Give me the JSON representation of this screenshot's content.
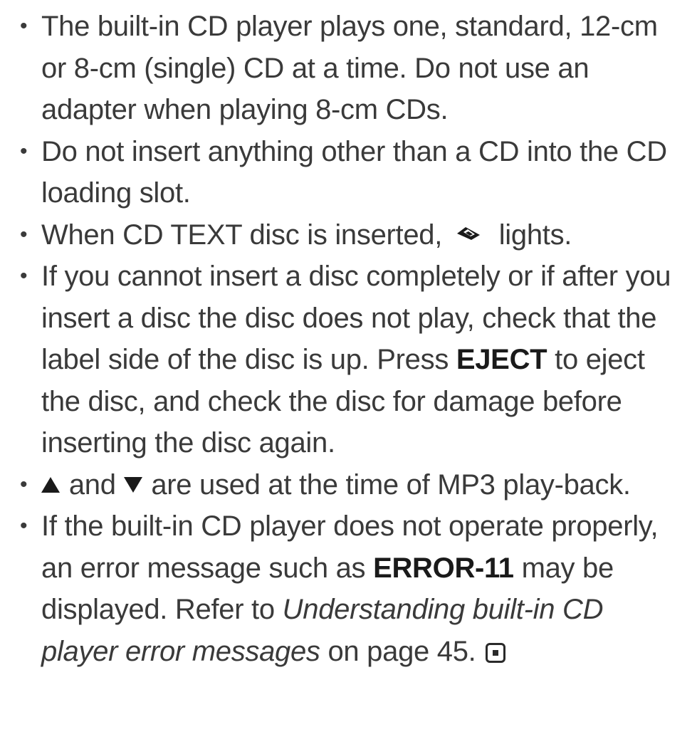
{
  "bullets": [
    {
      "text": "The built-in CD player plays one, standard, 12-cm or 8-cm (single) CD at a time. Do not use an adapter when playing 8-cm CDs."
    },
    {
      "text": "Do not insert anything other than a CD into the CD loading slot."
    },
    {
      "before": "When CD TEXT disc is inserted,",
      "icon": "cd-text-indicator-icon",
      "after": "lights."
    },
    {
      "before": "If you cannot insert a disc completely or if after you insert a disc the disc does not play, check that the label side of the disc is up. Press",
      "bold": "EJECT",
      "after": "to eject the disc, and check the disc for damage before inserting the disc again."
    },
    {
      "icon_up": "up-triangle-icon",
      "middle": "and",
      "icon_down": "down-triangle-icon",
      "after": "are used at the time of MP3 play-back."
    },
    {
      "before": "If the built-in CD player does not operate properly, an error message such as",
      "bold": "ERROR-11",
      "middle": "may be displayed. Refer to",
      "italic": "Understanding built-in CD player error messages",
      "after": "on page 45.",
      "end_icon": "end-of-section-icon"
    }
  ],
  "bullet_symbol": "•"
}
